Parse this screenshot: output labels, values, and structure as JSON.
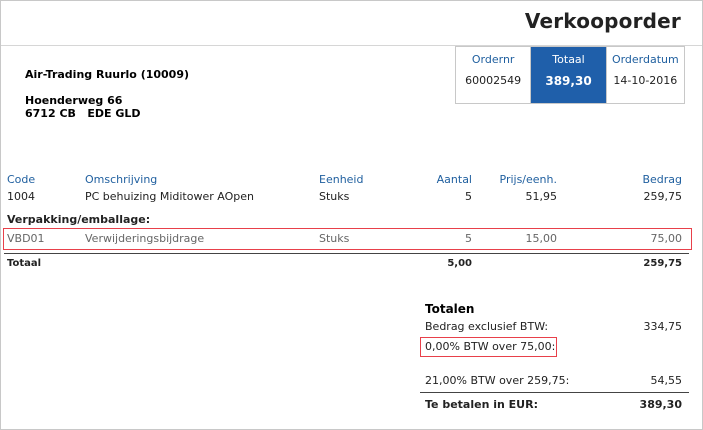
{
  "title": "Verkooporder",
  "customer": {
    "name": "Air-Trading Ruurlo (10009)",
    "street": "Hoenderweg 66",
    "postal_city": "6712 CB   EDE GLD"
  },
  "info": {
    "ordernr_label": "Ordernr",
    "ordernr_value": "60002549",
    "total_label": "Totaal",
    "total_value": "389,30",
    "date_label": "Orderdatum",
    "date_value": "14-10-2016"
  },
  "table": {
    "headers": {
      "code": "Code",
      "desc": "Omschrijving",
      "unit": "Eenheid",
      "qty": "Aantal",
      "price": "Prijs/eenh.",
      "amount": "Bedrag"
    },
    "rows": [
      {
        "code": "1004",
        "desc": "PC behuizing Miditower AOpen",
        "unit": "Stuks",
        "qty": "5",
        "price": "51,95",
        "amount": "259,75"
      }
    ],
    "section_label": "Verpakking/emballage:",
    "section_rows": [
      {
        "code": "VBD01",
        "desc": "Verwijderingsbijdrage",
        "unit": "Stuks",
        "qty": "5",
        "price": "15,00",
        "amount": "75,00"
      }
    ],
    "total_label": "Totaal",
    "total_qty": "5,00",
    "total_amount": "259,75"
  },
  "totals": {
    "heading": "Totalen",
    "excl_label": "Bedrag exclusief BTW:",
    "excl_value": "334,75",
    "vat0_label": "0,00% BTW over 75,00:",
    "vat21_label": "21,00% BTW over 259,75:",
    "vat21_value": "54,55",
    "pay_label": "Te betalen in EUR:",
    "pay_value": "389,30"
  },
  "colors": {
    "accent": "#1f5faa",
    "highlight": "#e8404a"
  }
}
